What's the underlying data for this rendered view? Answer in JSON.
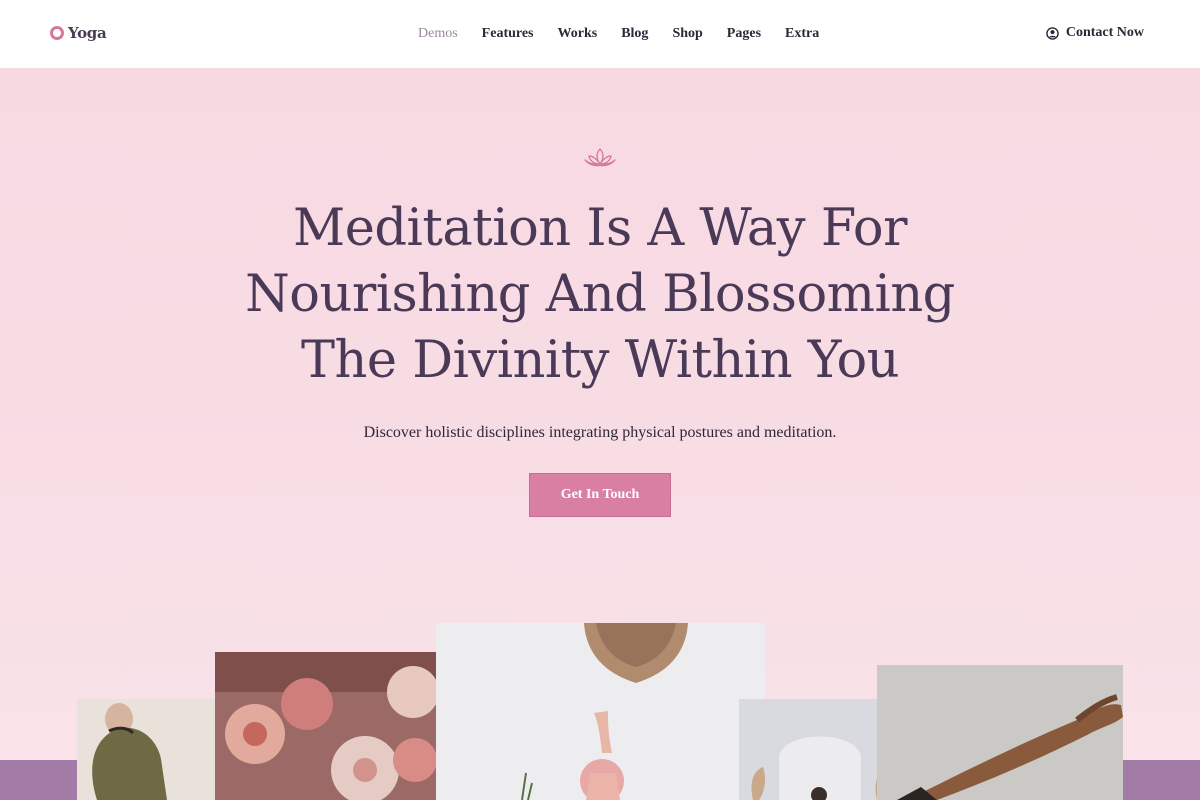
{
  "header": {
    "logo_text": "Yoga",
    "nav": [
      {
        "label": "Demos",
        "active": true
      },
      {
        "label": "Features",
        "active": false
      },
      {
        "label": "Works",
        "active": false
      },
      {
        "label": "Blog",
        "active": false
      },
      {
        "label": "Shop",
        "active": false
      },
      {
        "label": "Pages",
        "active": false
      },
      {
        "label": "Extra",
        "active": false
      }
    ],
    "contact_label": "Contact Now",
    "contact_icon": "user-circle-icon"
  },
  "hero": {
    "icon": "lotus-icon",
    "headline_lines": [
      "Meditation Is A Way For",
      "Nourishing And Blossoming",
      "The Divinity Within You"
    ],
    "subtitle": "Discover holistic disciplines integrating physical postures and meditation.",
    "cta_label": "Get In Touch"
  },
  "colors": {
    "accent": "#d97fa3",
    "headline": "#4a3a57",
    "band": "#a27ca6",
    "background": "#f7dde4"
  }
}
